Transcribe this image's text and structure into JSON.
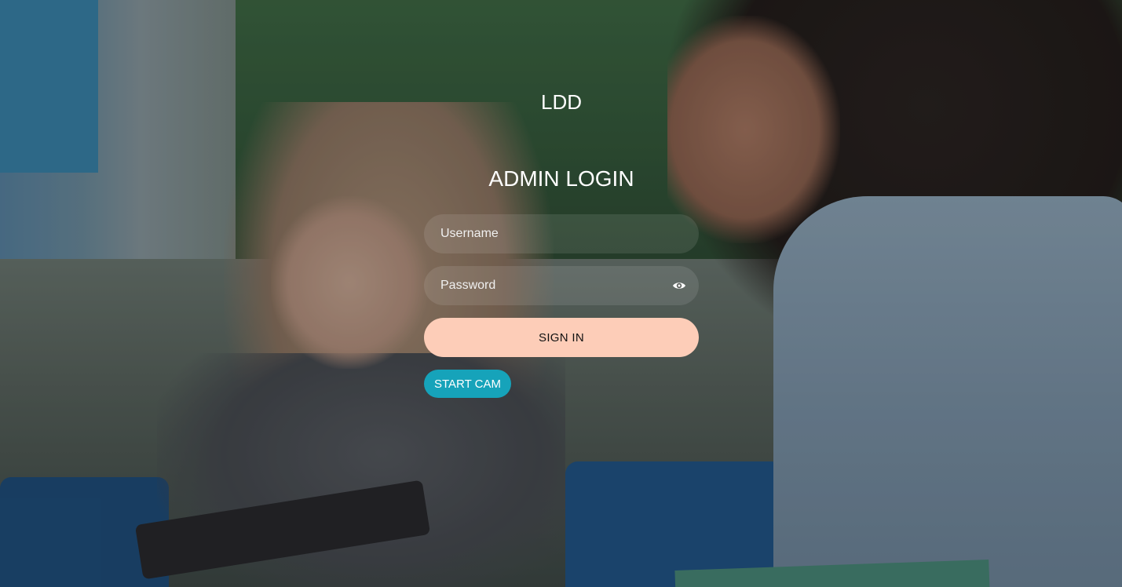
{
  "brand": "LDD",
  "heading": "ADMIN LOGIN",
  "form": {
    "username_placeholder": "Username",
    "password_placeholder": "Password",
    "password_toggle_icon": "eye-icon",
    "sign_in_label": "SIGN IN",
    "start_cam_label": "START CAM"
  },
  "colors": {
    "sign_in_button": "#fdcdb8",
    "start_cam_button": "#16a3ba",
    "text": "#ffffff"
  }
}
